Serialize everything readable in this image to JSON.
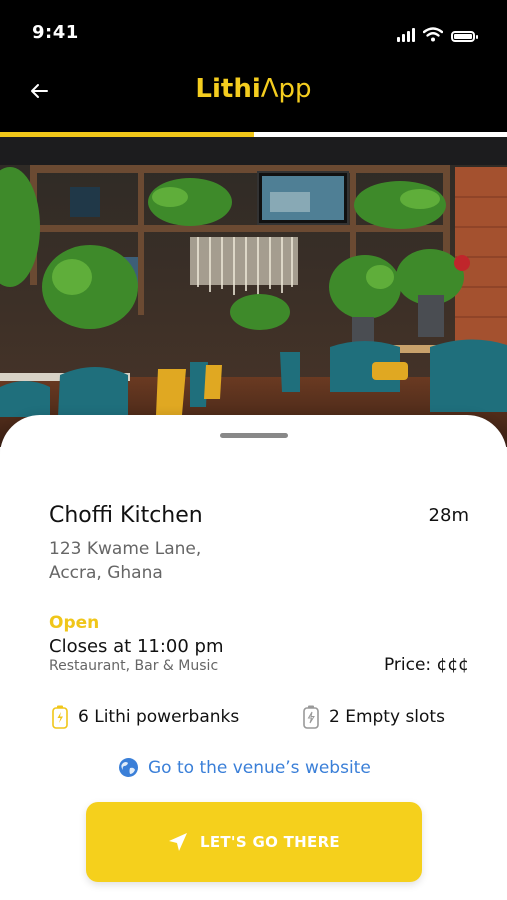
{
  "status_bar": {
    "time": "9:41"
  },
  "header": {
    "logo_bold": "Lithi",
    "logo_light": "Λpp",
    "progress": 0.5
  },
  "venue": {
    "name": "Choffi Kitchen",
    "distance": "28m",
    "address_line1": "123 Kwame Lane,",
    "address_line2": "Accra, Ghana",
    "status": "Open",
    "closes": "Closes at 11:00 pm",
    "category": "Restaurant, Bar & Music",
    "price": "Price: ¢¢¢",
    "powerbanks": "6 Lithi powerbanks",
    "empty_slots": "2 Empty slots",
    "website_link": "Go to the venue’s website"
  },
  "cta": {
    "label": "LET'S GO THERE"
  },
  "colors": {
    "accent": "#f5d01c",
    "link": "#3a7fd8",
    "status_open": "#f0c619"
  }
}
